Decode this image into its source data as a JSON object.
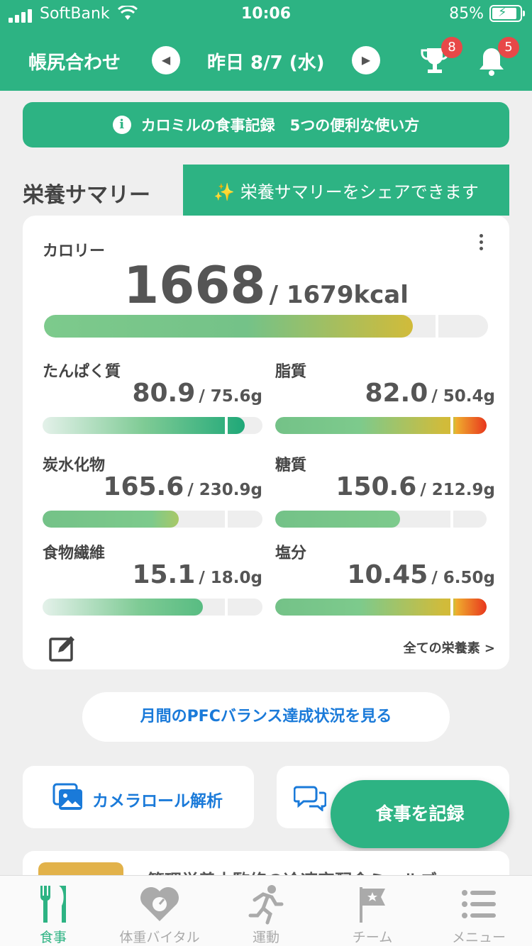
{
  "status": {
    "carrier": "SoftBank",
    "time": "10:06",
    "battery": "85%"
  },
  "header": {
    "group_name": "帳尻合わせ",
    "date": "昨日 8/7 (水)",
    "trophy_badge": "8",
    "bell_badge": "5"
  },
  "tips_banner": "カロミルの食事記録　5つの便利な使い方",
  "section_title": "栄養サマリー",
  "share_tooltip": "✨ 栄養サマリーをシェアできます",
  "calorie": {
    "label": "カロリー",
    "value": "1668",
    "target": "/ 1679kcal",
    "progress": 0.83
  },
  "nutrients": [
    {
      "label": "たんぱく質",
      "value": "80.9",
      "target": "/ 75.6g",
      "progress": 0.92
    },
    {
      "label": "脂質",
      "value": "82.0",
      "target": "/ 50.4g",
      "progress": 1.0
    },
    {
      "label": "炭水化物",
      "value": "165.6",
      "target": "/ 230.9g",
      "progress": 0.62
    },
    {
      "label": "糖質",
      "value": "150.6",
      "target": "/ 212.9g",
      "progress": 0.59
    },
    {
      "label": "食物繊維",
      "value": "15.1",
      "target": "/ 18.0g",
      "progress": 0.73
    },
    {
      "label": "塩分",
      "value": "10.45",
      "target": "/ 6.50g",
      "progress": 1.0
    }
  ],
  "all_nutrients_link": "全ての栄養素 >",
  "pfc_button": "月間のPFCバランス達成状況を見る",
  "camera_roll": "カメラロール解析",
  "record_button": "食事を記録",
  "promo_text": "管理栄養士監修の冷凍宅配食ミールズ",
  "tabs": [
    "食事",
    "体重バイタル",
    "運動",
    "チーム",
    "メニュー"
  ],
  "colors": {
    "brand": "#2db383",
    "link": "#1a7ad9",
    "badge": "#e84848"
  }
}
